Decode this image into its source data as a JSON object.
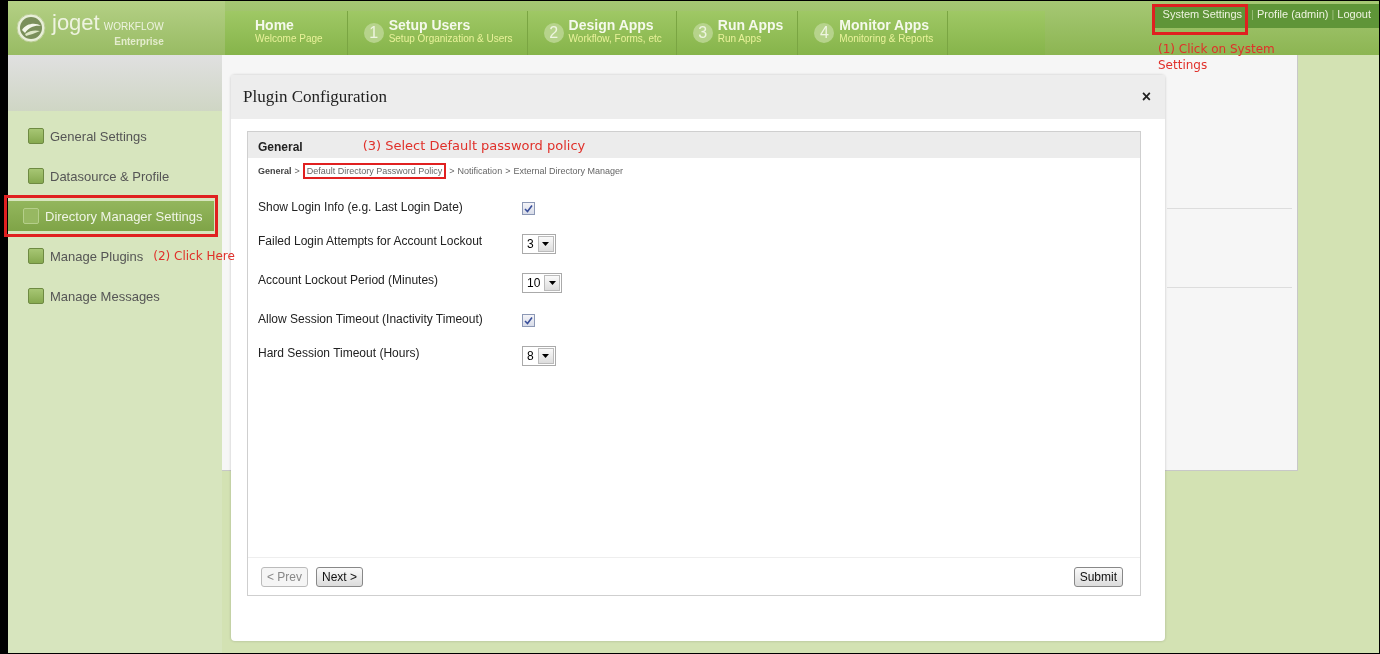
{
  "header": {
    "logo": {
      "name": "joget",
      "product": "WORKFLOW",
      "edition": "Enterprise"
    },
    "nav": [
      {
        "title": "Home",
        "subtitle": "Welcome Page"
      },
      {
        "step": "1",
        "title": "Setup Users",
        "subtitle": "Setup Organization & Users"
      },
      {
        "step": "2",
        "title": "Design Apps",
        "subtitle": "Workflow, Forms, etc"
      },
      {
        "step": "3",
        "title": "Run Apps",
        "subtitle": "Run Apps"
      },
      {
        "step": "4",
        "title": "Monitor Apps",
        "subtitle": "Monitoring & Reports"
      }
    ],
    "user_links": [
      {
        "label": "System Settings",
        "annotated": true
      },
      {
        "label": "Profile (admin)",
        "annotated": false
      },
      {
        "label": "Logout",
        "annotated": false
      }
    ],
    "separator": "|",
    "note": "(1) Click on System Settings"
  },
  "sidebar": {
    "items": [
      {
        "label": "General Settings",
        "selected": false,
        "annotated": false
      },
      {
        "label": "Datasource & Profile",
        "selected": false,
        "annotated": false
      },
      {
        "label": "Directory Manager Settings",
        "selected": true,
        "annotated": true
      },
      {
        "label": "Manage Plugins",
        "selected": false,
        "annotated": false,
        "note": "(2) Click Here"
      },
      {
        "label": "Manage Messages",
        "selected": false,
        "annotated": false
      }
    ]
  },
  "dialog": {
    "title": "Plugin Configuration",
    "close": "×",
    "section": {
      "title": "General",
      "note": "(3) Select Default password policy",
      "separator": ">",
      "breadcrumb": [
        {
          "label": "General",
          "selected": true,
          "annotated": false
        },
        {
          "label": "Default Directory Password Policy",
          "selected": false,
          "annotated": true
        },
        {
          "label": "Notification",
          "selected": false,
          "annotated": false
        },
        {
          "label": "External Directory Manager",
          "selected": false,
          "annotated": false
        }
      ],
      "fields": [
        {
          "kind": "checkbox",
          "label": "Show Login Info (e.g. Last Login Date)",
          "checked": true
        },
        {
          "kind": "select",
          "label": "Failed Login Attempts for Account Lockout",
          "value": "3"
        },
        {
          "kind": "select",
          "label": "Account Lockout Period (Minutes)",
          "value": "10"
        },
        {
          "kind": "checkbox",
          "label": "Allow Session Timeout (Inactivity Timeout)",
          "checked": true
        },
        {
          "kind": "select",
          "label": "Hard Session Timeout (Hours)",
          "value": "8"
        }
      ],
      "nav_buttons": [
        {
          "label": "< Prev",
          "disabled": true
        },
        {
          "label": "Next >",
          "disabled": false
        }
      ],
      "submit": {
        "label": "Submit"
      }
    }
  }
}
